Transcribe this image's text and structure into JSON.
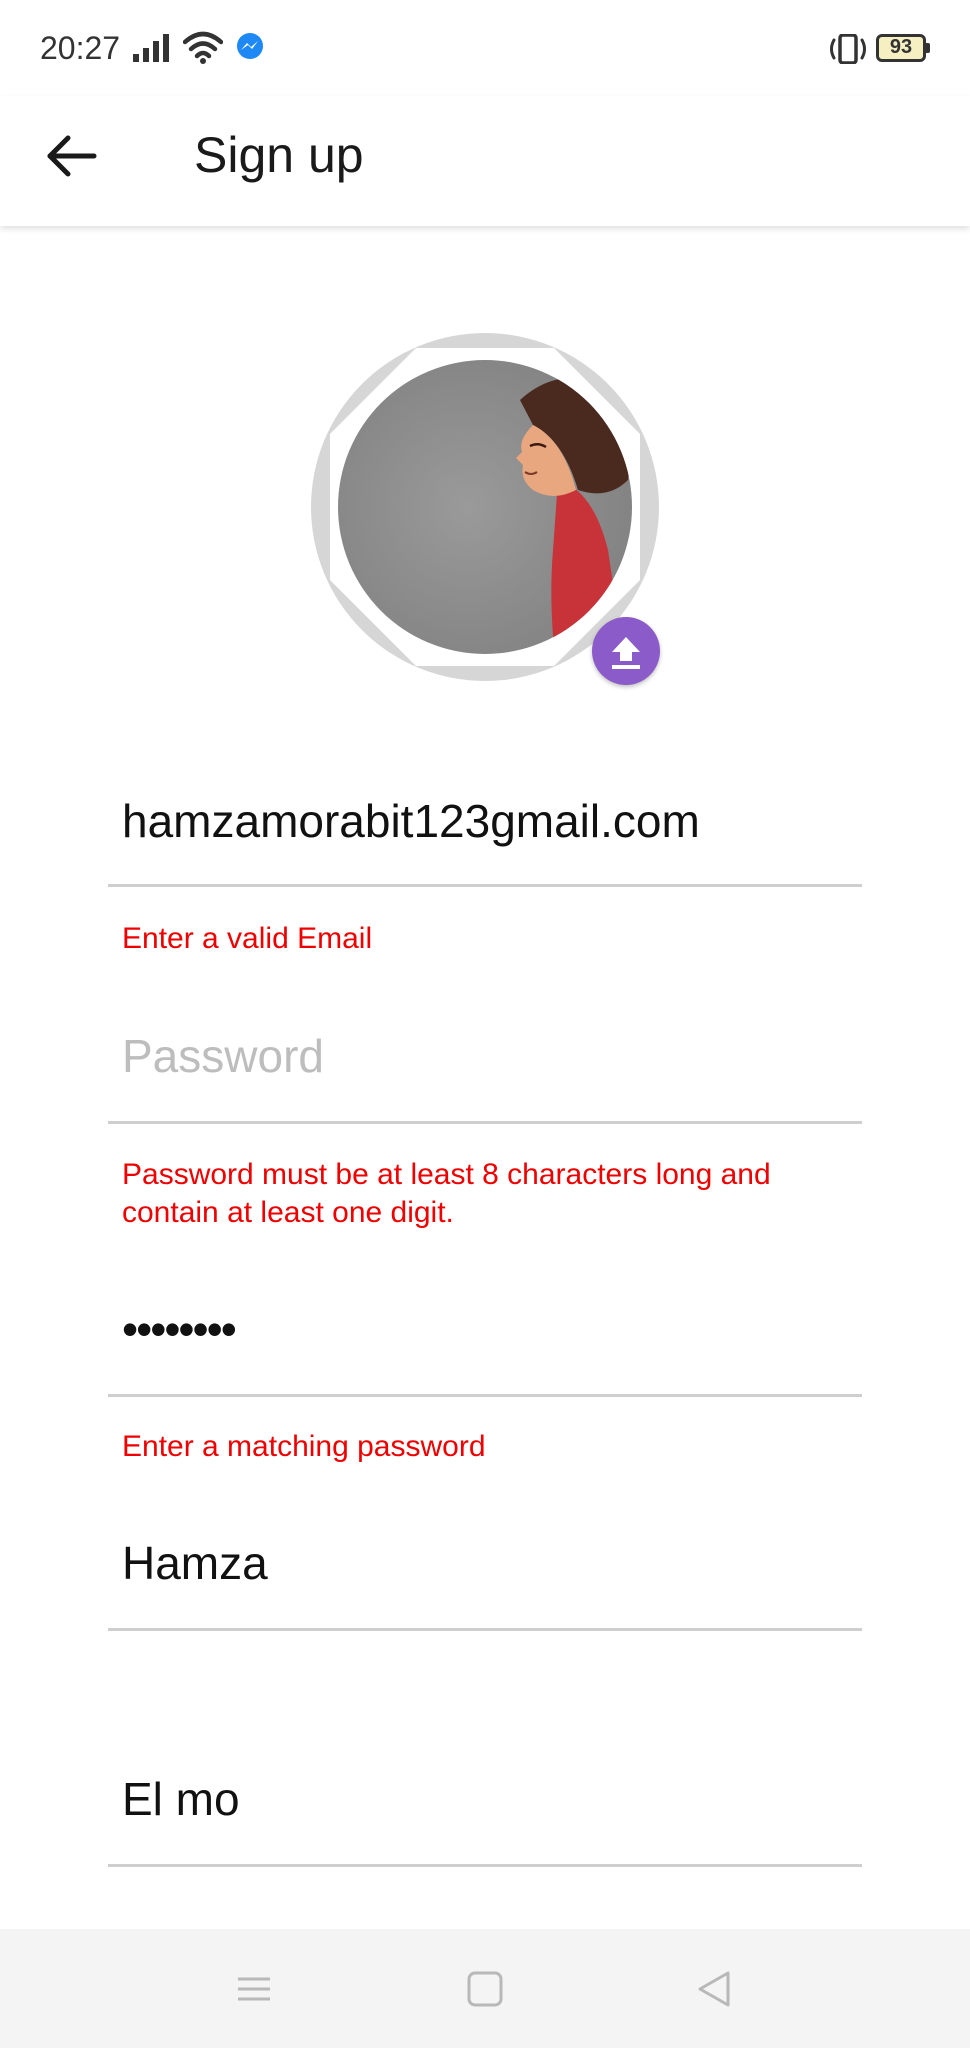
{
  "status_bar": {
    "time": "20:27",
    "battery": "93",
    "icons": [
      "signal-icon",
      "wifi-icon",
      "messenger-icon",
      "vibrate-icon",
      "battery-icon"
    ]
  },
  "app_bar": {
    "title": "Sign up",
    "back_icon": "arrow-left-icon"
  },
  "avatar": {
    "upload_icon": "upload-icon",
    "upload_color": "#8b5cc9"
  },
  "form": {
    "email": {
      "value": "hamzamorabit123gmail.com",
      "error": "Enter a valid Email"
    },
    "password": {
      "placeholder": "Password",
      "error": "Password must be at least 8 characters long and contain at least one digit."
    },
    "confirm_password": {
      "value": "••••••••",
      "error": "Enter a matching password"
    },
    "first_name": {
      "value": "Hamza"
    },
    "last_name": {
      "value": "El mo"
    }
  },
  "colors": {
    "error": "#ee0000",
    "underline": "#cfcfcf",
    "nav_background": "#f4f4f4"
  },
  "nav_bar": {
    "buttons": [
      "menu-icon",
      "home-icon",
      "back-triangle-icon"
    ]
  }
}
